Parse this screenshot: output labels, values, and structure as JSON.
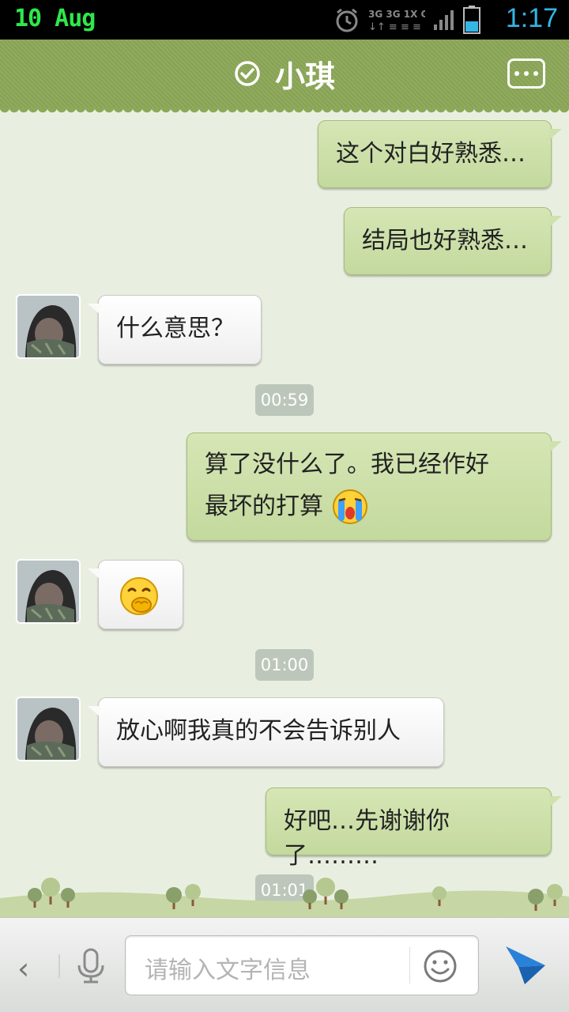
{
  "status_bar": {
    "date": "10 Aug",
    "time": "1:17",
    "net_top": "3G 3G 1X G"
  },
  "header": {
    "title": "小琪",
    "status_icon": "check-circle-icon",
    "menu_icon": "more-options-icon"
  },
  "messages": [
    {
      "side": "me",
      "text": "这个对白好熟悉…"
    },
    {
      "side": "me",
      "text": "结局也好熟悉…"
    },
    {
      "side": "them",
      "text": "什么意思？"
    },
    {
      "type": "timestamp",
      "text": "00:59"
    },
    {
      "side": "me",
      "line1": "算了没什么了。我已经作好",
      "line2": "最坏的打算",
      "emoji": "crying-face-icon"
    },
    {
      "side": "them",
      "emoji": "giggle-face-icon"
    },
    {
      "type": "timestamp",
      "text": "01:00"
    },
    {
      "side": "them",
      "text": "放心啊我真的不会告诉别人"
    },
    {
      "side": "me",
      "text": "好吧…先谢谢你了………"
    },
    {
      "type": "timestamp",
      "text": "01:01"
    }
  ],
  "input_bar": {
    "placeholder": "请输入文字信息",
    "back_icon": "chevron-left-icon",
    "mic_icon": "microphone-icon",
    "emoji_icon": "smiley-icon",
    "send_icon": "send-icon"
  },
  "colors": {
    "header_bg": "#8ca858",
    "chat_bg": "#e9efe0",
    "my_bubble": "#cfe1ad",
    "their_bubble": "#ffffff",
    "time_color": "#34b6e6",
    "date_color": "#2ee84a"
  }
}
